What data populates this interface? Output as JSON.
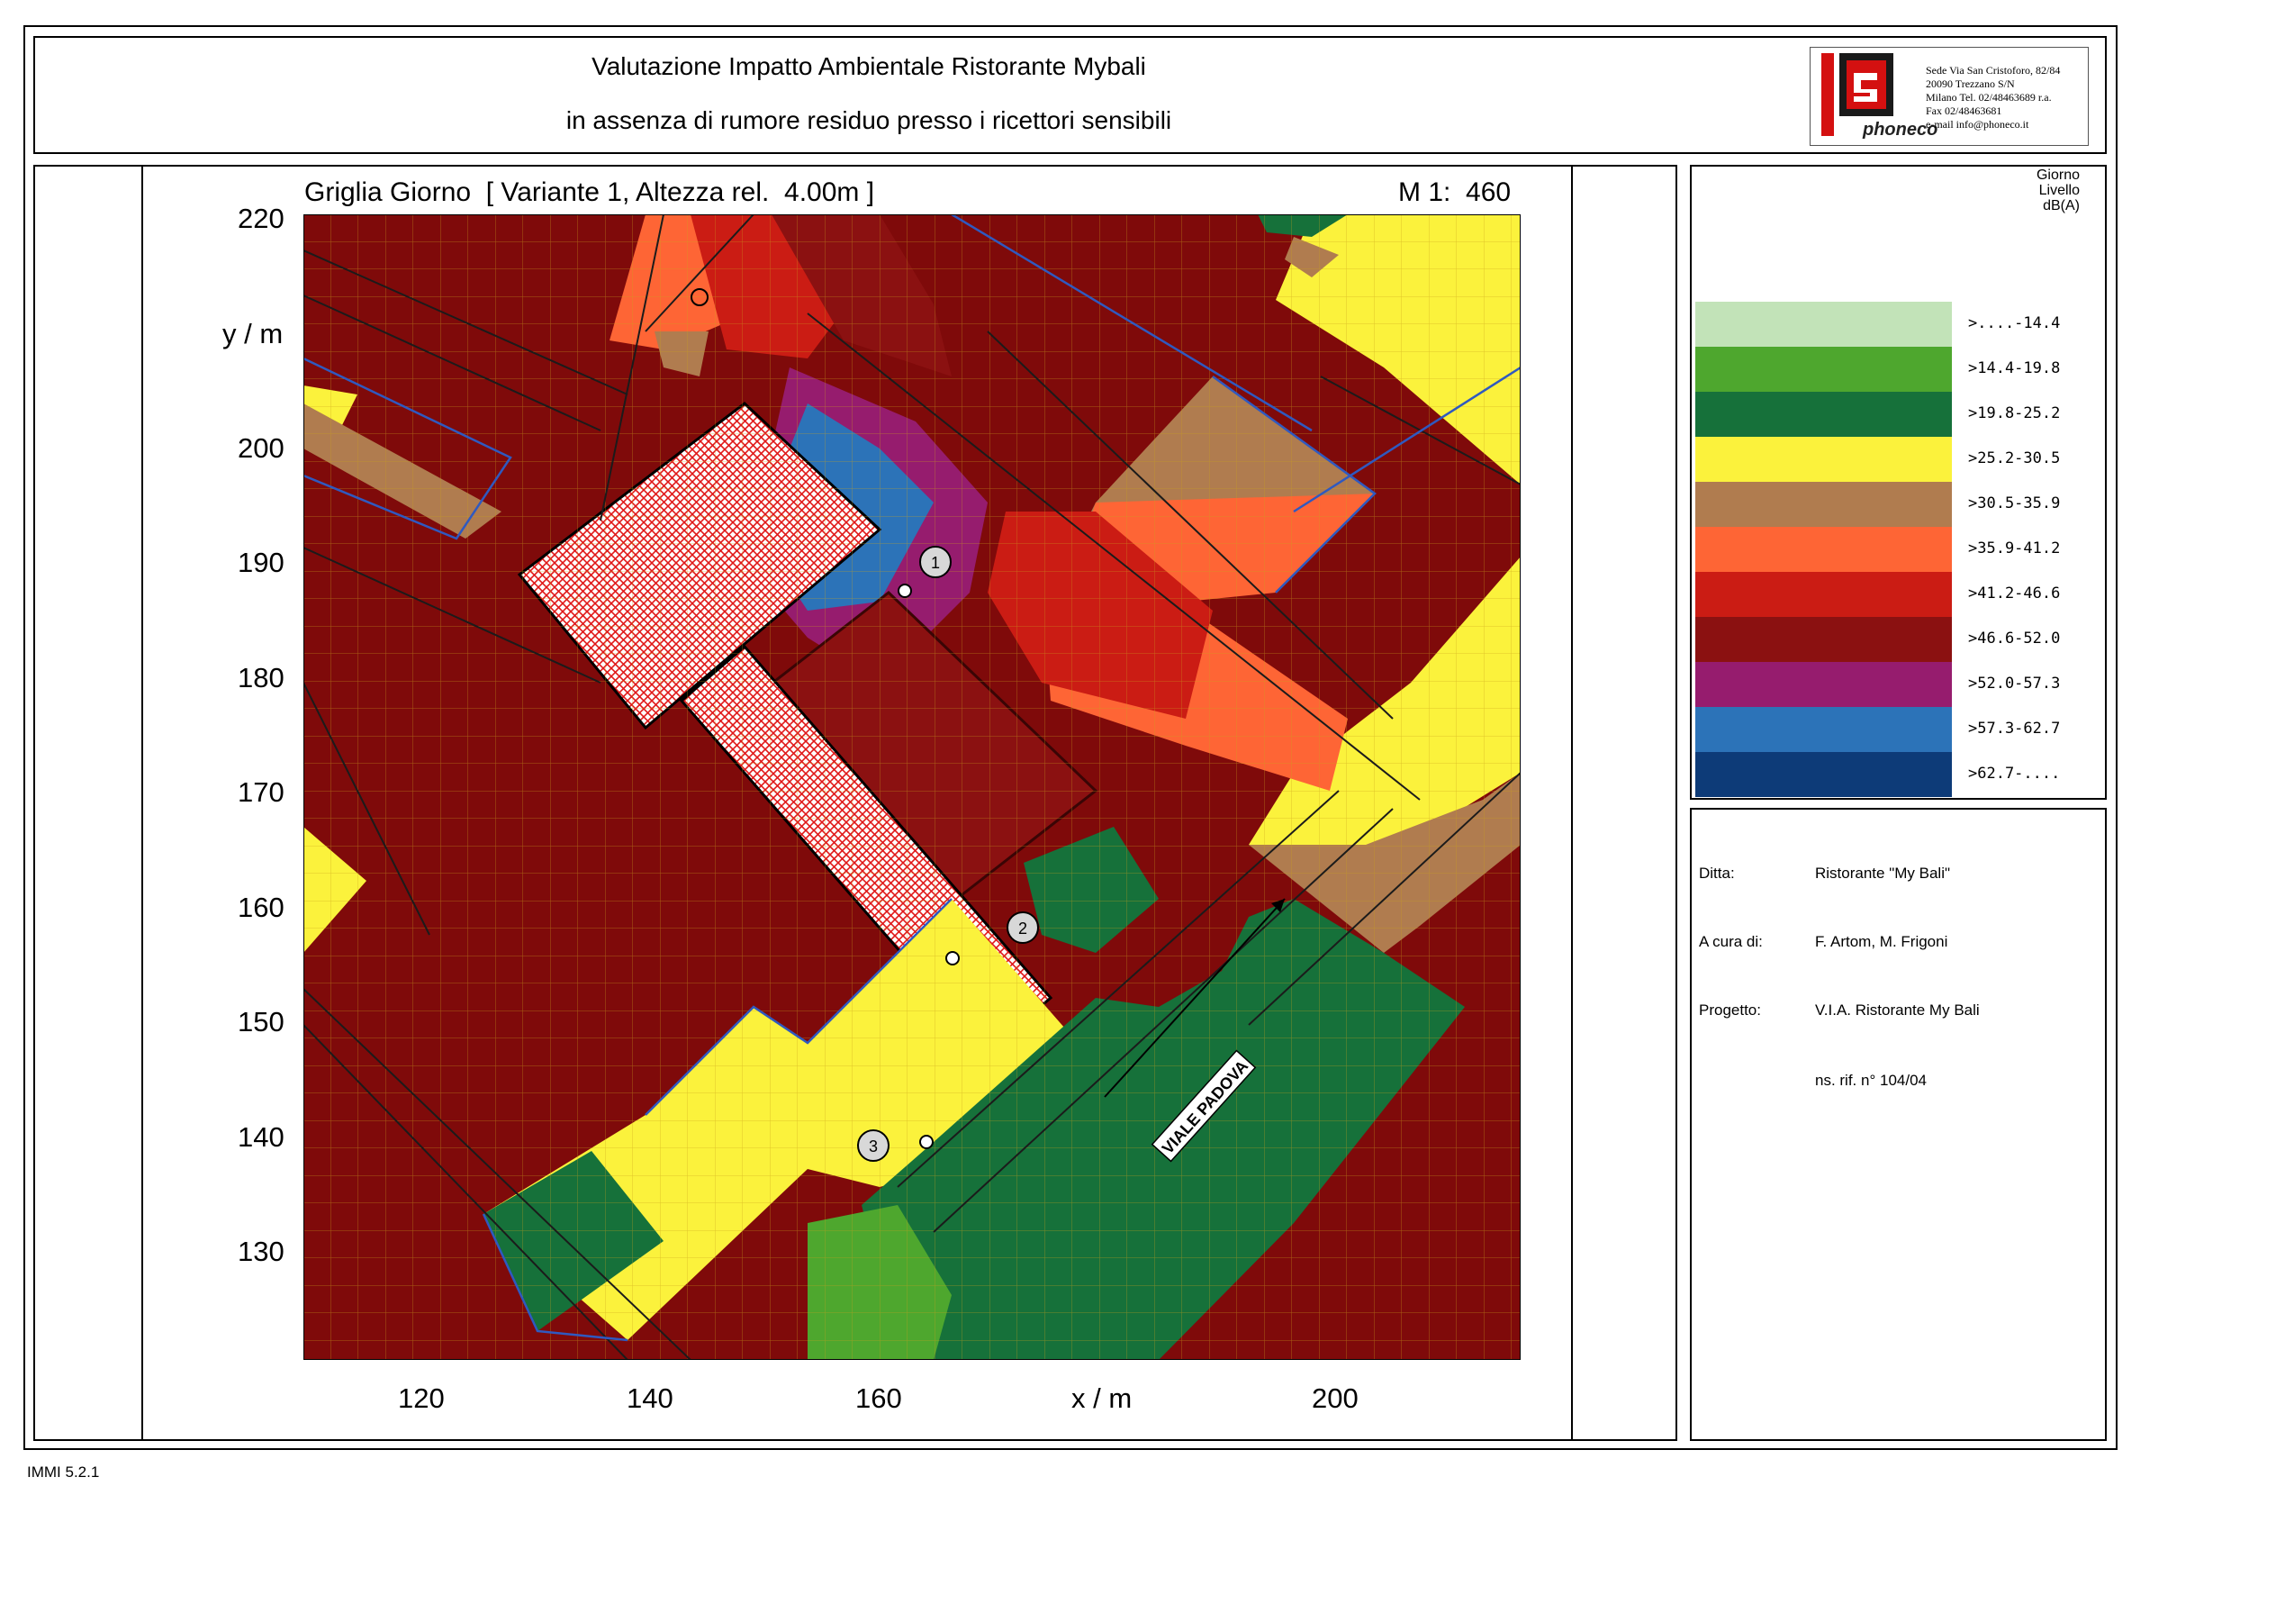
{
  "header": {
    "title_line1": "Valutazione Impatto Ambientale Ristorante Mybali",
    "title_line2": "in assenza di rumore residuo presso i ricettori sensibili"
  },
  "logo": {
    "brand": "phoneco",
    "address_lines": [
      "Sede Via San Cristoforo, 82/84",
      "20090 Trezzano S/N",
      "Milano Tel. 02/48463689 r.a.",
      "Fax 02/48463681",
      "e-mail info@phoneco.it"
    ]
  },
  "map": {
    "title": "Griglia Giorno  [ Variante 1, Altezza rel.  4.00m ]",
    "scale": "M 1:  460",
    "y_axis_label": "y / m",
    "x_axis_label": "x / m",
    "y_ticks": [
      "220",
      "210",
      "200",
      "190",
      "180",
      "170",
      "160",
      "150",
      "140",
      "130"
    ],
    "x_ticks": [
      "120",
      "140",
      "160",
      "200"
    ],
    "street_label": "VIALE PADOVA",
    "receptors": [
      "1",
      "2",
      "3"
    ]
  },
  "legend": {
    "title_lines": [
      "Giorno",
      "Livello",
      "dB(A)"
    ],
    "items": [
      {
        "label": ">....-14.4",
        "color": "#c2e3b8"
      },
      {
        "label": ">14.4-19.8",
        "color": "#4ea72e"
      },
      {
        "label": ">19.8-25.2",
        "color": "#16713a"
      },
      {
        "label": ">25.2-30.5",
        "color": "#fbf23c"
      },
      {
        "label": ">30.5-35.9",
        "color": "#b07c4f"
      },
      {
        "label": ">35.9-41.2",
        "color": "#fe6535"
      },
      {
        "label": ">41.2-46.6",
        "color": "#cb1c14"
      },
      {
        "label": ">46.6-52.0",
        "color": "#8b1111"
      },
      {
        "label": ">52.0-57.3",
        "color": "#961c6e"
      },
      {
        "label": ">57.3-62.7",
        "color": "#2c73b8"
      },
      {
        "label": ">62.7-....",
        "color": "#0d3b78"
      }
    ]
  },
  "info": {
    "ditta_label": "Ditta:",
    "ditta_value": "Ristorante \"My Bali\"",
    "acura_label": "A cura di:",
    "acura_value": "F. Artom, M. Frigoni",
    "progetto_label": "Progetto:",
    "progetto_value": "V.I.A. Ristorante My Bali",
    "ref_value": "ns. rif. n° 104/04"
  },
  "footer": {
    "software": "IMMI 5.2.1"
  }
}
